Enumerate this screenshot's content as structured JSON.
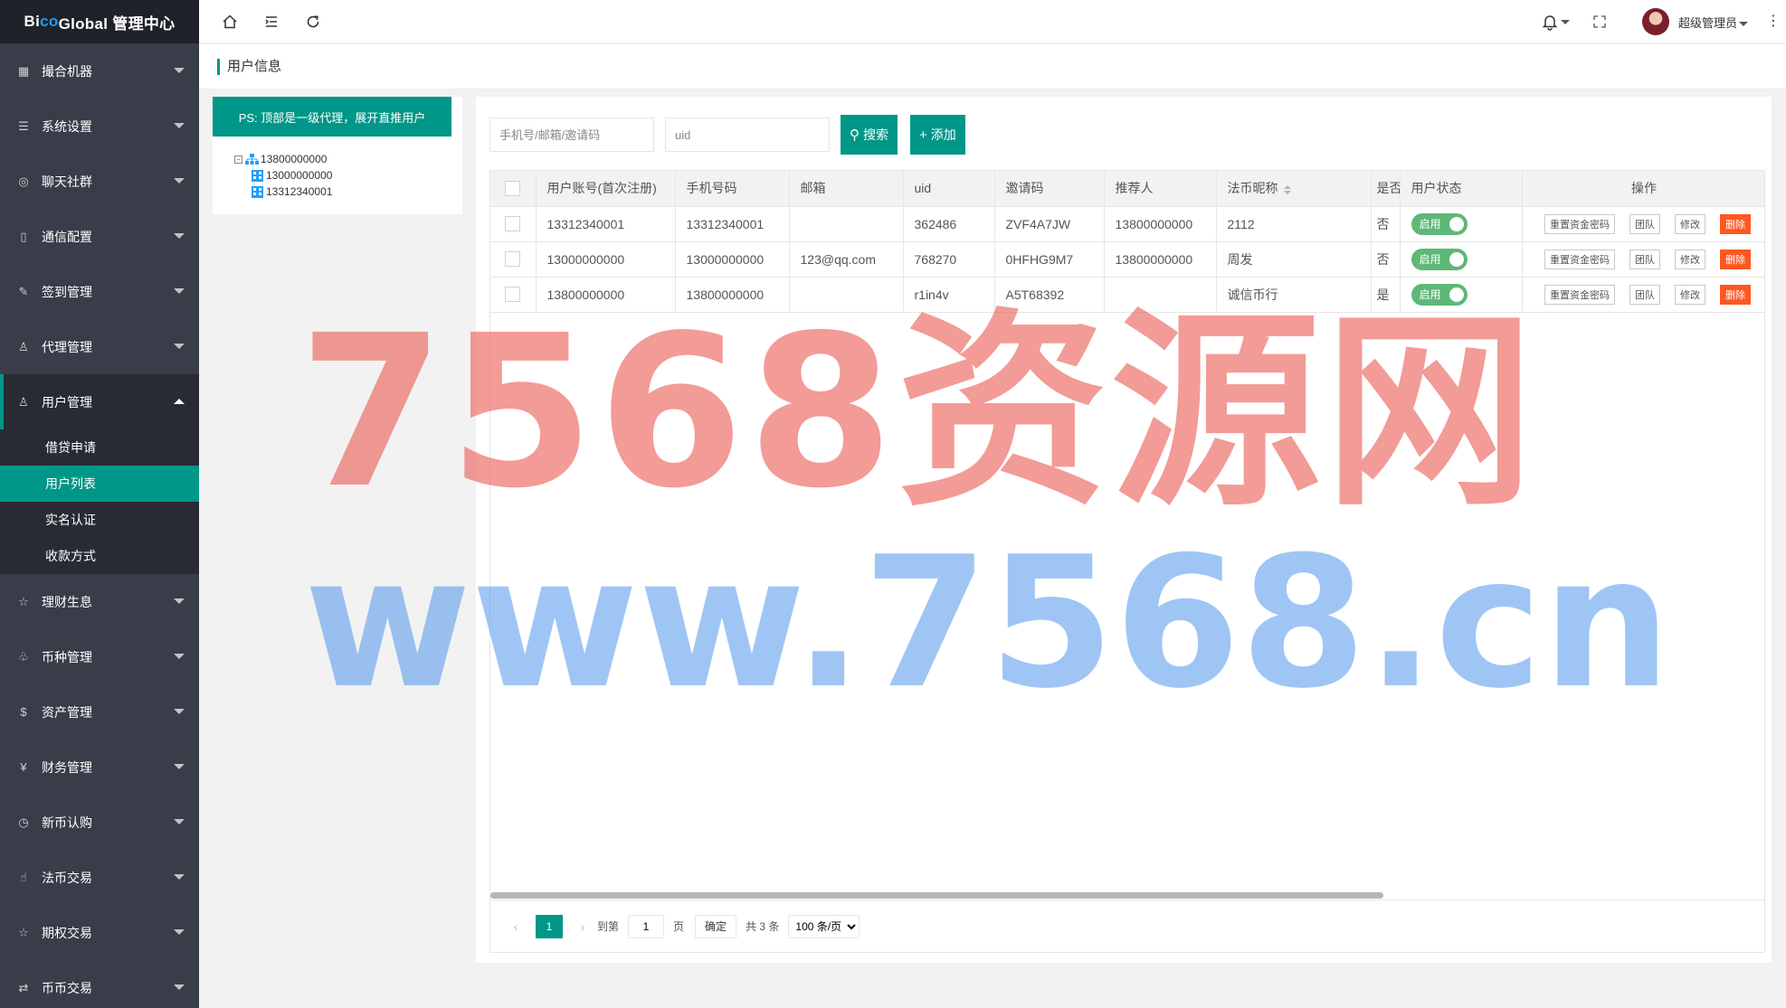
{
  "brand": {
    "part1": "Bi",
    "part2": "co",
    "part3": " Global 管理中心"
  },
  "sidebar": {
    "items": [
      {
        "label": "撮合机器",
        "icon": "robot-icon"
      },
      {
        "label": "系统设置",
        "icon": "sliders-icon"
      },
      {
        "label": "聊天社群",
        "icon": "chat-icon"
      },
      {
        "label": "通信配置",
        "icon": "phone-icon"
      },
      {
        "label": "签到管理",
        "icon": "checkin-icon"
      },
      {
        "label": "代理管理",
        "icon": "person-icon"
      },
      {
        "label": "用户管理",
        "icon": "users-icon"
      }
    ],
    "submenu": [
      {
        "label": "借贷申请"
      },
      {
        "label": "用户列表"
      },
      {
        "label": "实名认证"
      },
      {
        "label": "收款方式"
      }
    ],
    "items_after": [
      {
        "label": "理财生息",
        "icon": "star-icon"
      },
      {
        "label": "币种管理",
        "icon": "coins-icon"
      },
      {
        "label": "资产管理",
        "icon": "dollar-icon"
      },
      {
        "label": "财务管理",
        "icon": "yen-icon"
      },
      {
        "label": "新币认购",
        "icon": "clock-icon"
      },
      {
        "label": "法币交易",
        "icon": "hand-icon"
      },
      {
        "label": "期权交易",
        "icon": "star-icon"
      },
      {
        "label": "币币交易",
        "icon": "exchange-icon"
      }
    ]
  },
  "header": {
    "user_name": "超级管理员"
  },
  "page_title": "用户信息",
  "tree": {
    "ps_text": "PS: 顶部是一级代理，展开直推用户",
    "root": "13800000000",
    "children": [
      "13000000000",
      "13312340001"
    ]
  },
  "toolbar": {
    "phone_placeholder": "手机号/邮箱/邀请码",
    "uid_placeholder": "uid",
    "search_label": "搜索",
    "add_label": "添加"
  },
  "table": {
    "headers": [
      "用户账号(首次注册)",
      "手机号码",
      "邮箱",
      "uid",
      "邀请码",
      "推荐人",
      "法币昵称",
      "是否",
      "用户状态",
      "操作"
    ],
    "rows": [
      {
        "account": "13312340001",
        "phone": "13312340001",
        "email": "",
        "uid": "362486",
        "invite": "ZVF4A7JW",
        "referrer": "13800000000",
        "nickname": "2112",
        "flag": "否",
        "status": "启用"
      },
      {
        "account": "13000000000",
        "phone": "13000000000",
        "email": "123@qq.com",
        "uid": "768270",
        "invite": "0HFHG9M7",
        "referrer": "13800000000",
        "nickname": "周发",
        "flag": "否",
        "status": "启用"
      },
      {
        "account": "13800000000",
        "phone": "13800000000",
        "email": "",
        "uid": "r1in4v",
        "invite": "A5T68392",
        "referrer": "",
        "nickname": "诚信币行",
        "flag": "是",
        "status": "启用"
      }
    ],
    "actions": {
      "reset": "重置资金密码",
      "team": "团队",
      "edit": "修改",
      "delete": "删除"
    }
  },
  "pager": {
    "current": "1",
    "goto_label": "到第",
    "page_value": "1",
    "page_unit": "页",
    "confirm": "确定",
    "total": "共 3 条",
    "per_page": "100 条/页"
  },
  "watermark": {
    "line1": "7568资源网",
    "line2": "www.7568.cn"
  },
  "colors": {
    "primary": "#009688",
    "sidebar": "#393d49",
    "danger": "#FF5722",
    "switch_on": "#5FB878"
  }
}
